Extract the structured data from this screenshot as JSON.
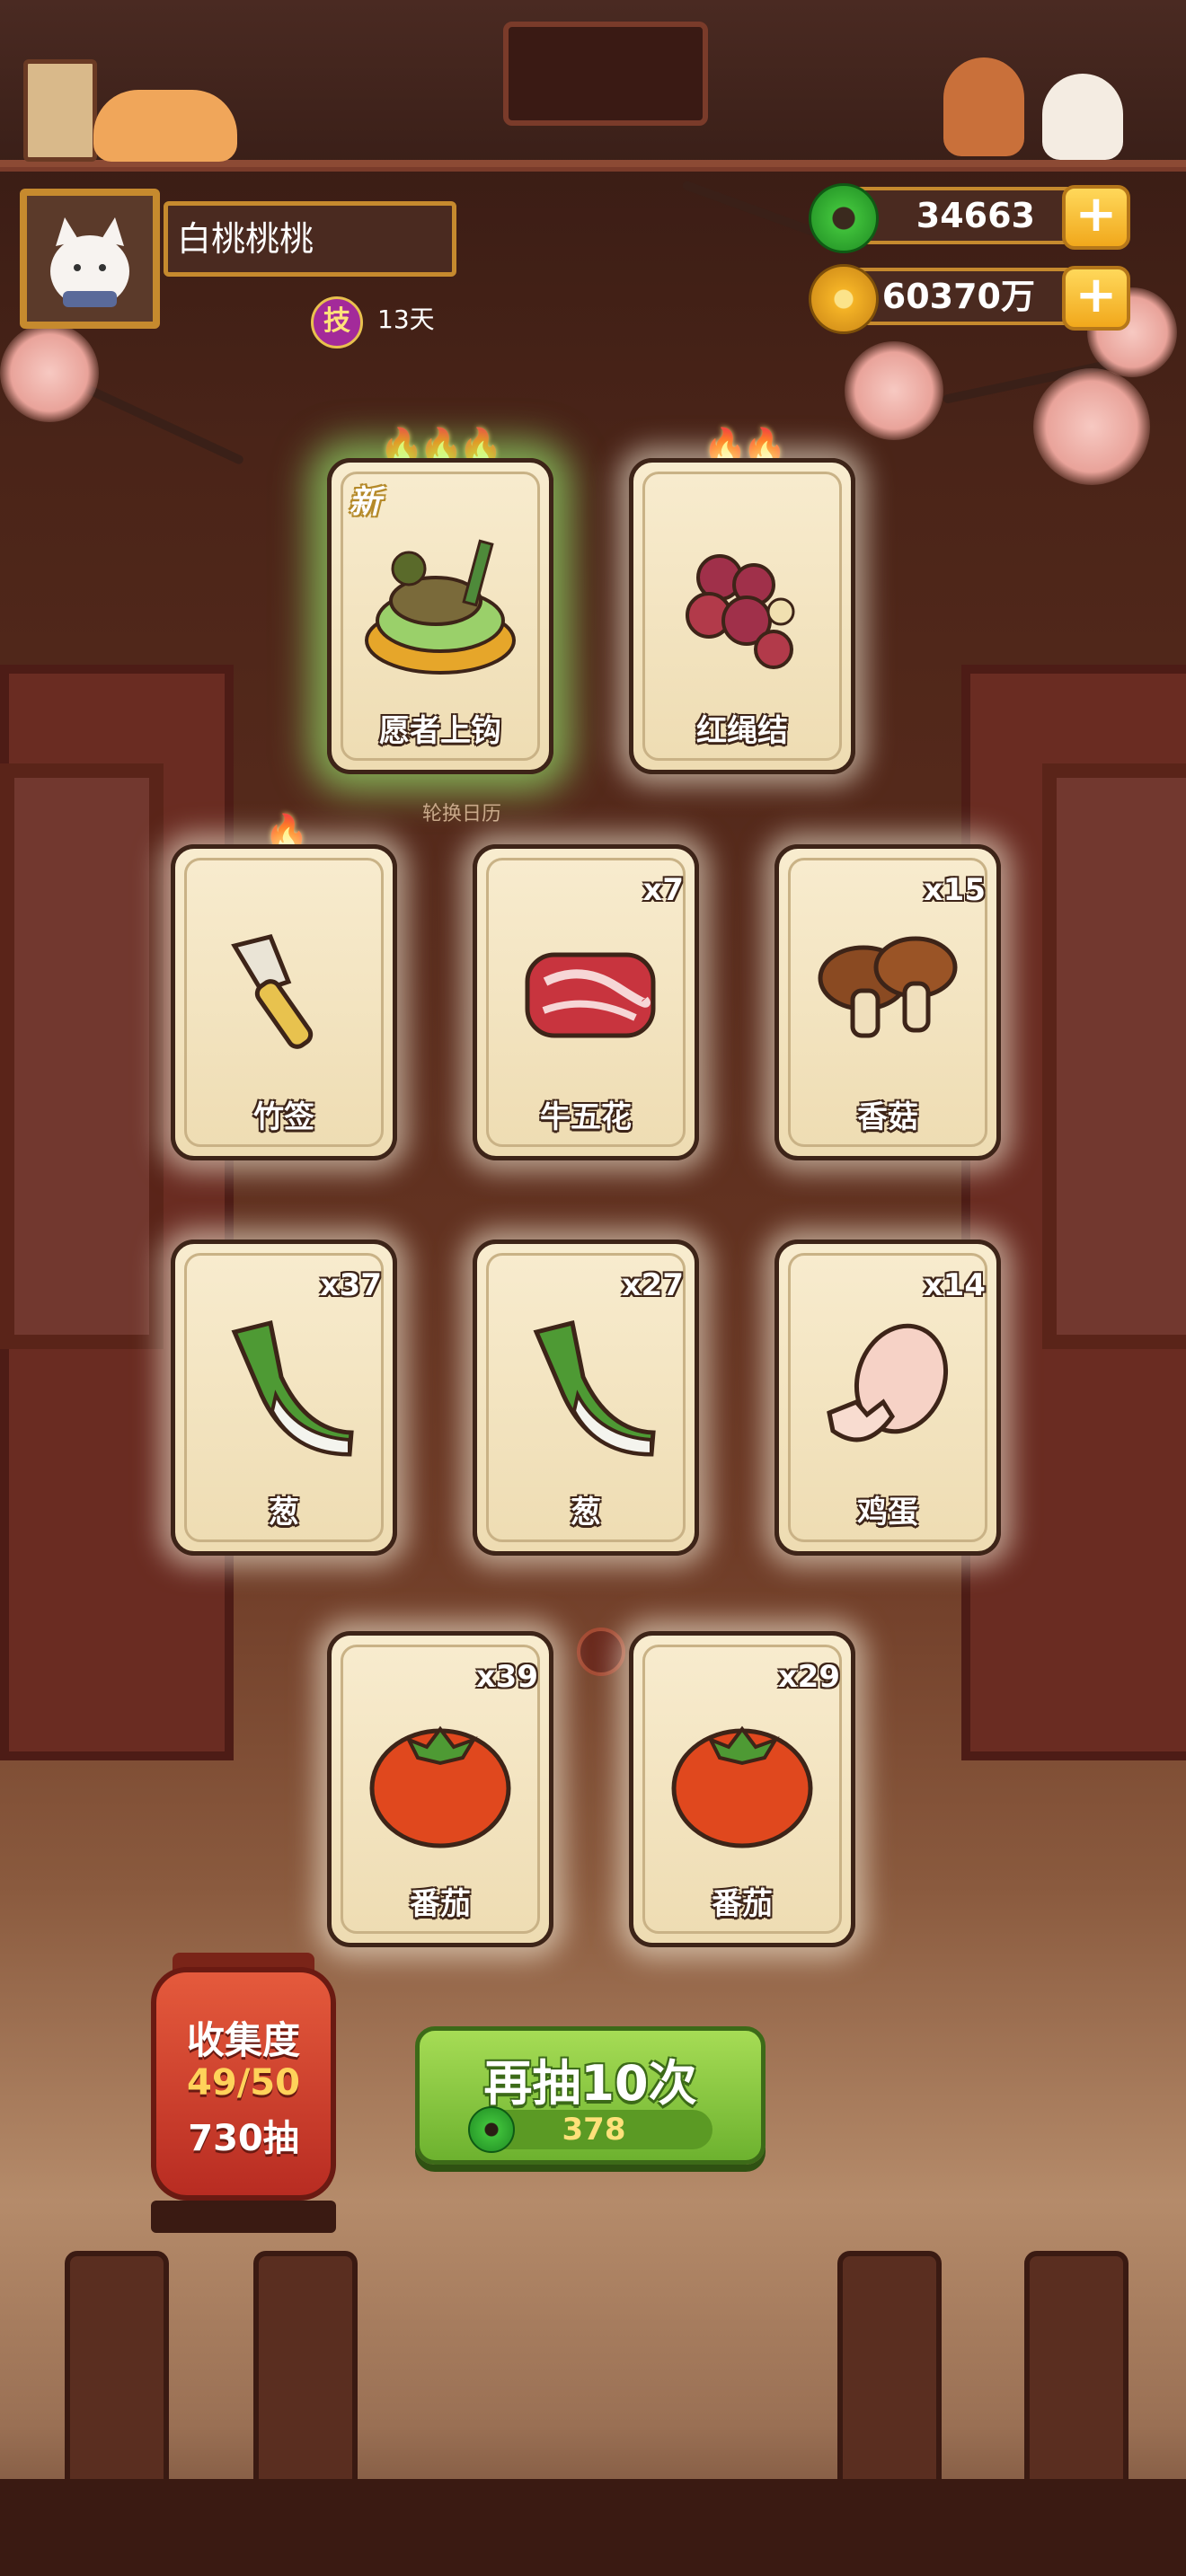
{
  "player": {
    "name": "白桃桃桃",
    "skill_badge": "技",
    "days": "13天"
  },
  "currencies": {
    "jade": {
      "value": "34663",
      "icon": "jade-coin-icon"
    },
    "gold": {
      "value": "60370万",
      "icon": "gold-coin-icon"
    },
    "add_label": "+"
  },
  "featured_cards": [
    {
      "label": "愿者上钩",
      "flames": 3,
      "is_new": true,
      "new_label": "新",
      "count": ""
    },
    {
      "label": "红绳结",
      "flames": 2,
      "is_new": false,
      "count": ""
    }
  ],
  "calendar_label": "轮换日历",
  "cards": [
    {
      "label": "竹签",
      "count": "",
      "flames": 1
    },
    {
      "label": "牛五花",
      "count": "x7"
    },
    {
      "label": "香菇",
      "count": "x15"
    },
    {
      "label": "葱",
      "count": "x37"
    },
    {
      "label": "葱",
      "count": "x27"
    },
    {
      "label": "鸡蛋",
      "count": "x14"
    },
    {
      "label": "番茄",
      "count": "x39"
    },
    {
      "label": "番茄",
      "count": "x29"
    }
  ],
  "collection": {
    "title": "收集度",
    "progress": "49/50",
    "draws": "730抽"
  },
  "draw_button": {
    "label": "再抽10次",
    "cost": "378"
  },
  "colors": {
    "accent_gold": "#c68a2e",
    "button_green": "#6db22f",
    "card_bg": "#f8eccf"
  }
}
